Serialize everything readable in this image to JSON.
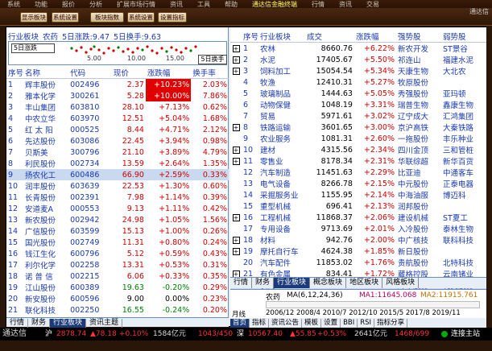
{
  "menubar": [
    "系统",
    "功能",
    "报价",
    "分析",
    "扩展市场行情",
    "资讯",
    "工具",
    "帮助",
    "通达信金融终端",
    "行情",
    "资讯",
    "交易"
  ],
  "toolbar": [
    "显示板块",
    "系统设置",
    "板块指数",
    "系统设置",
    "设置指标"
  ],
  "logo": "通达信",
  "left": {
    "header": {
      "board_label": "行业板块",
      "board_name": "农药",
      "day_change": "5日涨跌:9.47",
      "day_turnover": "5日换手:9.63"
    },
    "spark_button": "5日涨跌",
    "switch_button": "5日换手",
    "scale": [
      "5.00",
      "10.00",
      "15.00"
    ],
    "columns": [
      "序号",
      "名称",
      "代码",
      "现价",
      "涨跌幅",
      "换手率"
    ],
    "rows": [
      {
        "idx": "1",
        "name": "辉丰股份",
        "code": "002496",
        "price": "2.37",
        "chg": "+10.23%",
        "turn": "2.03%",
        "tag": true
      },
      {
        "idx": "2",
        "name": "雅本化学",
        "code": "300261",
        "price": "5.28",
        "chg": "+10.00%",
        "turn": "7.86%",
        "tag": true
      },
      {
        "idx": "3",
        "name": "丰山集团",
        "code": "603810",
        "price": "28.10",
        "chg": "+7.13%",
        "turn": "0.62%"
      },
      {
        "idx": "4",
        "name": "中农立华",
        "code": "603970",
        "price": "12.51",
        "chg": "+5.04%",
        "turn": "1.68%"
      },
      {
        "idx": "5",
        "name": "红 太 阳",
        "code": "000525",
        "price": "8.44",
        "chg": "+4.71%",
        "turn": "2.12%"
      },
      {
        "idx": "6",
        "name": "先达股份",
        "code": "603086",
        "price": "22.45",
        "chg": "+3.94%",
        "turn": "0.98%"
      },
      {
        "idx": "7",
        "name": "贝斯美",
        "code": "300796",
        "price": "21.10",
        "chg": "+3.89%",
        "turn": "4.79%"
      },
      {
        "idx": "8",
        "name": "利民股份",
        "code": "002734",
        "price": "13.59",
        "chg": "+2.64%",
        "turn": "1.35%"
      },
      {
        "idx": "9",
        "name": "扬农化工",
        "code": "600486",
        "price": "66.90",
        "chg": "+2.59%",
        "turn": "0.33%",
        "sel": true
      },
      {
        "idx": "10",
        "name": "润丰股份",
        "code": "603639",
        "price": "22.53",
        "chg": "+1.30%",
        "turn": "0.60%"
      },
      {
        "idx": "11",
        "name": "长青股份",
        "code": "002391",
        "price": "7.98",
        "chg": "+1.14%",
        "turn": "0.39%"
      },
      {
        "idx": "12",
        "name": "安道麦A",
        "code": "000553",
        "price": "9.13",
        "chg": "+1.11%",
        "turn": "0.42%"
      },
      {
        "idx": "13",
        "name": "新农股份",
        "code": "002942",
        "price": "24.98",
        "chg": "+1.05%",
        "turn": "1.56%"
      },
      {
        "idx": "14",
        "name": "广信股份",
        "code": "603599",
        "price": "15.13",
        "chg": "+1.00%",
        "turn": "0.26%"
      },
      {
        "idx": "15",
        "name": "国光股份",
        "code": "002749",
        "price": "11.31",
        "chg": "+0.80%",
        "turn": "0.24%"
      },
      {
        "idx": "16",
        "name": "钱江生化",
        "code": "600796",
        "price": "5.12",
        "chg": "+0.59%",
        "turn": "0.43%"
      },
      {
        "idx": "17",
        "name": "利尔化学",
        "code": "002258",
        "price": "13.31",
        "chg": "+0.53%",
        "turn": "0.31%"
      },
      {
        "idx": "18",
        "name": "诺 普 信",
        "code": "002215",
        "price": "6.06",
        "chg": "+0.33%",
        "turn": "0.35%"
      },
      {
        "idx": "19",
        "name": "江山股份",
        "code": "600389",
        "price": "19.63",
        "chg": "-0.20%",
        "turn": "0.29%",
        "down": true
      },
      {
        "idx": "20",
        "name": "新安股份",
        "code": "600596",
        "price": "9.00",
        "chg": "0.00%",
        "turn": "0.23%",
        "flat": true
      },
      {
        "idx": "21",
        "name": "联化科技",
        "code": "002250",
        "price": "16.55",
        "chg": "-0.24%",
        "turn": "0.20%",
        "down": true
      },
      {
        "idx": "22",
        "name": "中旗股份",
        "code": "300575",
        "price": "23.83",
        "chg": "-1.08%",
        "turn": "1.41%",
        "down": true
      }
    ],
    "tabs": [
      "行情",
      "财务",
      "行业板块",
      "资讯主题"
    ]
  },
  "right": {
    "columns": [
      "序号",
      "行业板块",
      "成交",
      "涨跌幅",
      "强势股",
      "弱势股"
    ],
    "rows": [
      {
        "idx": "1",
        "name": "农林",
        "vol": "8660.76",
        "chg": "+6.22%",
        "lead": "新农开发",
        "lag": "ST景谷"
      },
      {
        "idx": "2",
        "name": "水泥",
        "vol": "17405.67",
        "chg": "+5.50%",
        "lead": "祁连山",
        "lag": "福建水泥"
      },
      {
        "idx": "3",
        "name": "饲料加工",
        "vol": "15054.54",
        "chg": "+5.34%",
        "lead": "天康生物",
        "lag": "大北农"
      },
      {
        "idx": "4",
        "name": "牧渔",
        "vol": "12410.31",
        "chg": "+5.27%",
        "lead": "牧原股份",
        "lag": ""
      },
      {
        "idx": "5",
        "name": "玻璃制品",
        "vol": "1444.63",
        "chg": "+5.05%",
        "lead": "秀强股份",
        "lag": "亚玛顿"
      },
      {
        "idx": "6",
        "name": "动物保健",
        "vol": "1048.19",
        "chg": "+3.31%",
        "lead": "瑞普生物",
        "lag": "鑫康生物"
      },
      {
        "idx": "7",
        "name": "贸易",
        "vol": "5971.61",
        "chg": "+3.02%",
        "lead": "辽宁成大",
        "lag": "汇鸿集团"
      },
      {
        "idx": "8",
        "name": "铁路运输",
        "vol": "3601.65",
        "chg": "+3.00%",
        "lead": "京沪高铁",
        "lag": "大秦铁路"
      },
      {
        "idx": "9",
        "name": "农业服务",
        "vol": "1081.31",
        "chg": "+2.60%",
        "lead": "一拖股份",
        "lag": "丰乐种业"
      },
      {
        "idx": "10",
        "name": "建材",
        "vol": "4315.56",
        "chg": "+2.34%",
        "lead": "四川金顶",
        "lag": "三和管桩"
      },
      {
        "idx": "11",
        "name": "零售业",
        "vol": "8178.34",
        "chg": "+2.31%",
        "lead": "华联综超",
        "lag": "新华百货"
      },
      {
        "idx": "12",
        "name": "汽车制造",
        "vol": "11451.63",
        "chg": "+2.29%",
        "lead": "比亚迪",
        "lag": "中通客车"
      },
      {
        "idx": "13",
        "name": "电气设备",
        "vol": "8266.78",
        "chg": "+2.15%",
        "lead": "中元股份",
        "lag": "正泰电器"
      },
      {
        "idx": "14",
        "name": "采掘服务业",
        "vol": "1155.95",
        "chg": "+2.14%",
        "lead": "中海油服",
        "lag": "博迈科"
      },
      {
        "idx": "15",
        "name": "重型机械",
        "vol": "696.41",
        "chg": "+2.13%",
        "lead": "润邦股份",
        "lag": ""
      },
      {
        "idx": "16",
        "name": "工程机械",
        "vol": "11868.37",
        "chg": "+2.06%",
        "lead": "建设机械",
        "lag": "ST夏工"
      },
      {
        "idx": "17",
        "name": "专用设备",
        "vol": "9713.69",
        "chg": "+2.01%",
        "lead": "入冷股份",
        "lag": "泰林生物"
      },
      {
        "idx": "18",
        "name": "材料",
        "vol": "942.76",
        "chg": "+2.00%",
        "lead": "中广核技",
        "lag": "联科科技"
      },
      {
        "idx": "19",
        "name": "摩托自行车",
        "vol": "4624.38",
        "chg": "+1.85%",
        "lead": "新日股份",
        "lag": ""
      },
      {
        "idx": "20",
        "name": "汽车配件",
        "vol": "11853.02",
        "chg": "+1.76%",
        "lead": "贵航股份",
        "lag": "北特科技"
      },
      {
        "idx": "21",
        "name": "有色金属",
        "vol": "834.41",
        "chg": "+1.72%",
        "lead": "藏格控股",
        "lag": "云南锗业"
      },
      {
        "idx": "22",
        "name": "农药",
        "vol": "11711.47",
        "chg": "+1.64%",
        "lead": "辉丰股份",
        "lag": "利民股份",
        "sel": true
      }
    ],
    "tabs": [
      "行情",
      "财务",
      "行业板块",
      "概念板块",
      "地区板块",
      "风格板块"
    ]
  },
  "kline": {
    "name": "农药",
    "ma": "MA(6,12,24,36)",
    "ma1": "MA1:11645.068",
    "ma2": "MA2:11915.761",
    "row_label": "月线",
    "years": "2006/12 2008/4 2010/7 2012/10 2015/5 2017/8 2019/11",
    "buttons": [
      "首页",
      "指标",
      "资讯公告",
      "模板",
      "设置",
      "BBI",
      "RSI",
      "指标分享"
    ]
  },
  "status": {
    "brand": "通达信",
    "sh_label": "沪",
    "sh_index": "2878.74",
    "sh_chg": "▲78.18",
    "sh_pct": "+0.10%",
    "sh_amt": "1584亿元",
    "sh_updown": "1043/450",
    "sz_label": "深",
    "sz_index": "10567.40",
    "sz_chg": "▲55.85",
    "sz_pct": "+0.53%",
    "sz_amt": "2641亿元",
    "sz_updown": "1468/699",
    "conn": "连接主站"
  },
  "colors": {
    "up": "#d00000",
    "down": "#008000",
    "accent": "#1a3ab0",
    "selected": "#c9daf0",
    "frame": "#2a1608"
  }
}
